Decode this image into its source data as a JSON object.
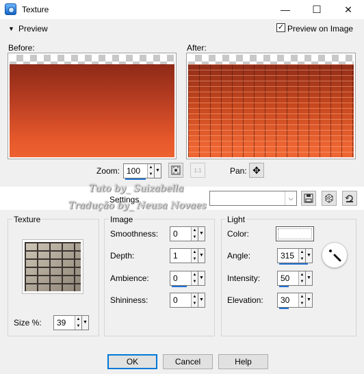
{
  "window": {
    "title": "Texture",
    "minimize": "—",
    "maximize": "☐",
    "close": "✕"
  },
  "preview": {
    "toggle_label": "Preview",
    "preview_on_image_label": "Preview on Image",
    "before_label": "Before:",
    "after_label": "After:"
  },
  "zoom": {
    "label": "Zoom:",
    "value": "100",
    "pan_label": "Pan:"
  },
  "watermark": {
    "line1": "Tuto by_ Suizabella",
    "line2": "Tradução by_ Neusa Novaes"
  },
  "settings": {
    "label": "Settings",
    "value": ""
  },
  "texture": {
    "group_label": "Texture",
    "size_label": "Size %:",
    "size_value": "39"
  },
  "image": {
    "group_label": "Image",
    "smoothness_label": "Smoothness:",
    "smoothness_value": "0",
    "depth_label": "Depth:",
    "depth_value": "1",
    "ambience_label": "Ambience:",
    "ambience_value": "0",
    "shininess_label": "Shininess:",
    "shininess_value": "0"
  },
  "light": {
    "group_label": "Light",
    "color_label": "Color:",
    "color_value": "#ffffff",
    "angle_label": "Angle:",
    "angle_value": "315",
    "intensity_label": "Intensity:",
    "intensity_value": "50",
    "elevation_label": "Elevation:",
    "elevation_value": "30"
  },
  "buttons": {
    "ok": "OK",
    "cancel": "Cancel",
    "help": "Help"
  },
  "colors": {
    "accent": "#0078d7",
    "dialog_bg": "#f0f0f0"
  }
}
